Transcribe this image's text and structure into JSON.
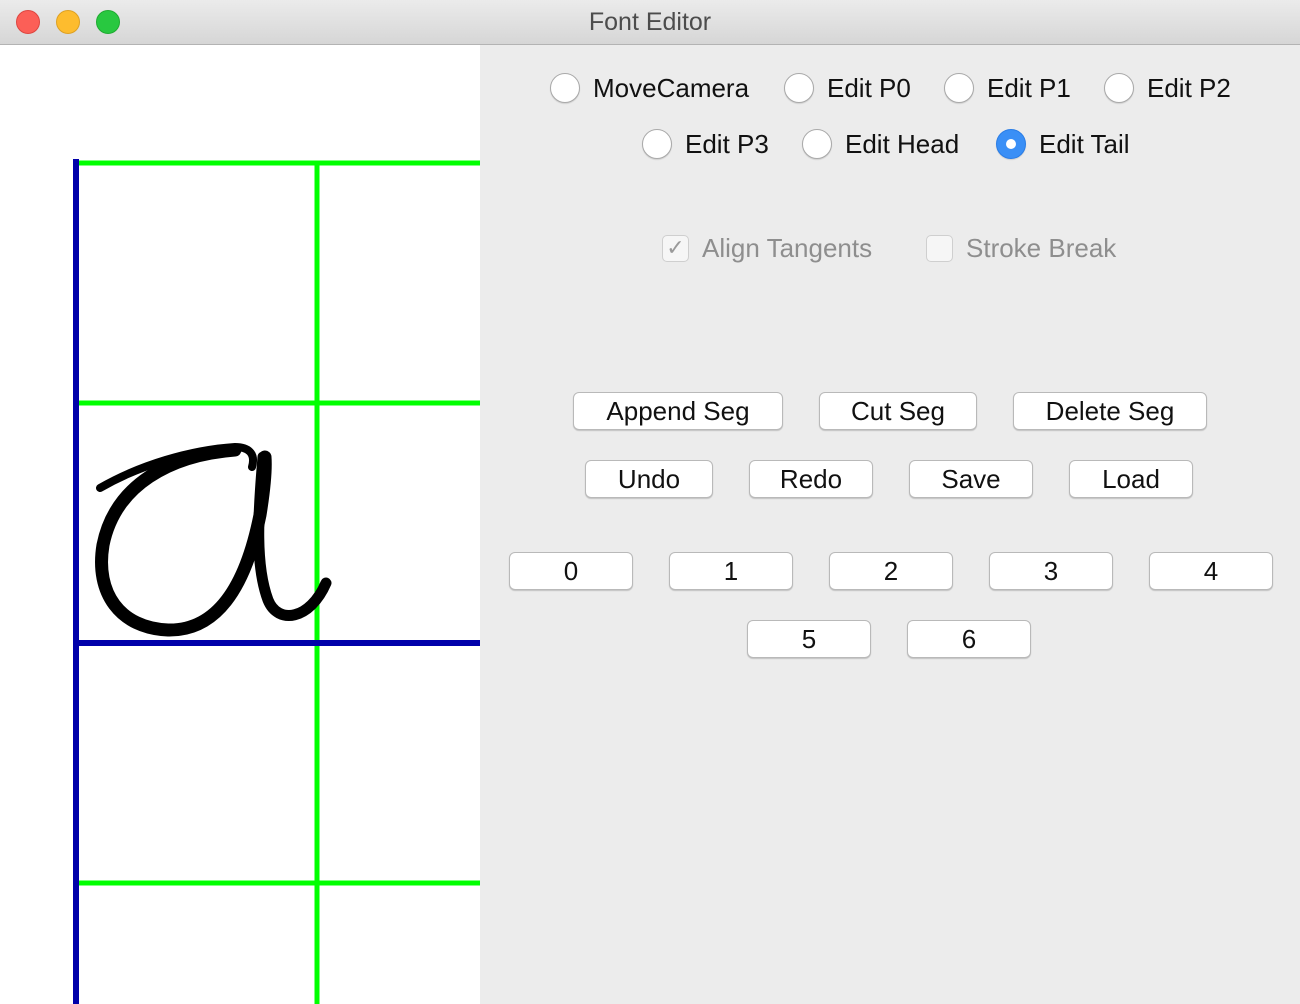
{
  "window": {
    "title": "Font Editor"
  },
  "colors": {
    "guide_green": "#00ff00",
    "guide_blue": "#0000aa",
    "glyph_ink": "#000000",
    "radio_selected": "#3a8ff6"
  },
  "canvas": {
    "glyph_icon": "cursive-letter-a-glyph"
  },
  "edit_modes": {
    "options": [
      {
        "label": "MoveCamera",
        "selected": false
      },
      {
        "label": "Edit P0",
        "selected": false
      },
      {
        "label": "Edit P1",
        "selected": false
      },
      {
        "label": "Edit P2",
        "selected": false
      },
      {
        "label": "Edit P3",
        "selected": false
      },
      {
        "label": "Edit Head",
        "selected": false
      },
      {
        "label": "Edit Tail",
        "selected": true
      }
    ]
  },
  "options": {
    "align_tangents": {
      "label": "Align Tangents",
      "checked": true,
      "enabled": false
    },
    "stroke_break": {
      "label": "Stroke Break",
      "checked": false,
      "enabled": false
    }
  },
  "segment_buttons": {
    "append": "Append Seg",
    "cut": "Cut Seg",
    "delete": "Delete Seg"
  },
  "file_buttons": {
    "undo": "Undo",
    "redo": "Redo",
    "save": "Save",
    "load": "Load"
  },
  "number_buttons": [
    "0",
    "1",
    "2",
    "3",
    "4",
    "5",
    "6"
  ]
}
